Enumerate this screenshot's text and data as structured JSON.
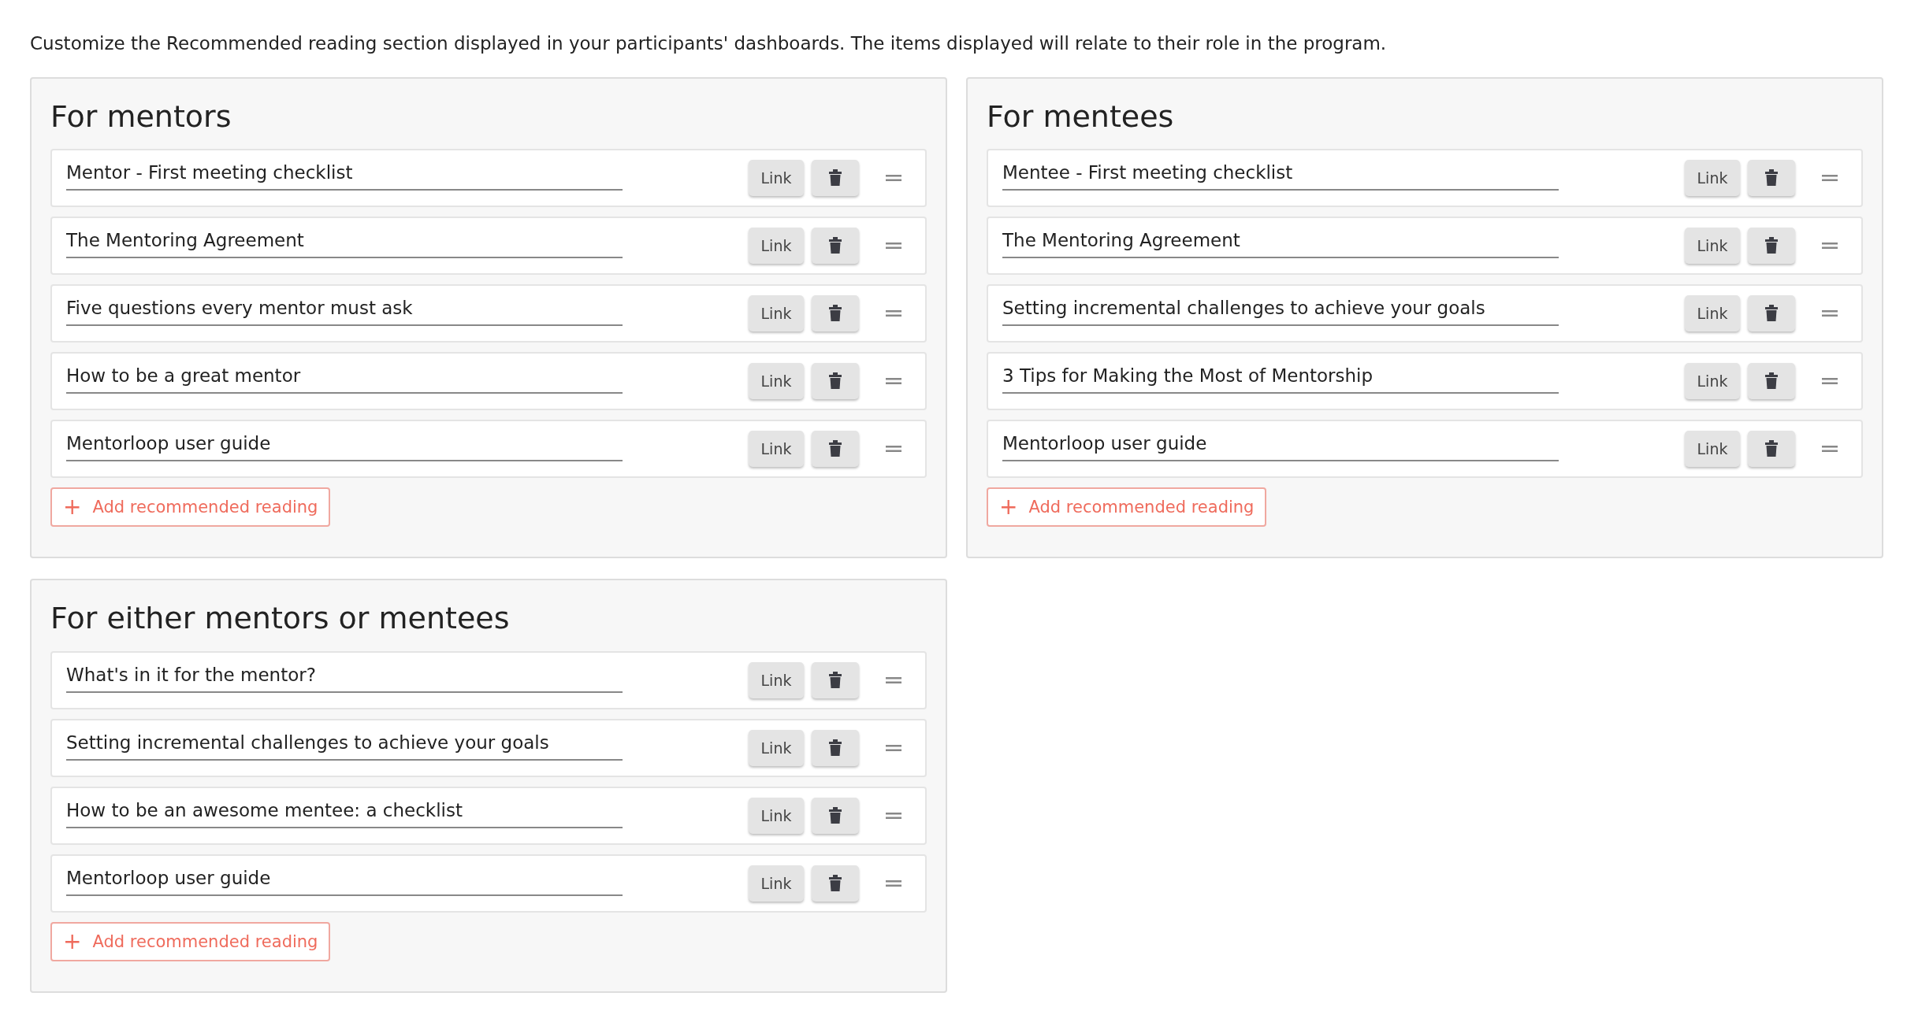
{
  "intro": "Customize the Recommended reading section displayed in your participants' dashboards. The items displayed will relate to their role in the program.",
  "sections": [
    {
      "title": "For mentors",
      "items": [
        {
          "value": "Mentor - First meeting checklist",
          "link": "Link"
        },
        {
          "value": "The Mentoring Agreement",
          "link": "Link"
        },
        {
          "value": "Five questions every mentor must ask",
          "link": "Link"
        },
        {
          "value": "How to be a great mentor",
          "link": "Link"
        },
        {
          "value": "Mentorloop user guide",
          "link": "Link"
        }
      ],
      "add_button": {
        "icon": "+",
        "label": "Add recommended reading"
      }
    },
    {
      "title": "For mentees",
      "items": [
        {
          "value": "Mentee - First meeting checklist",
          "link": "Link"
        },
        {
          "value": "The Mentoring Agreement",
          "link": "Link"
        },
        {
          "value": "Setting incremental challenges to achieve your goals",
          "link": "Link"
        },
        {
          "value": "3 Tips for Making the Most of Mentorship",
          "link": "Link"
        },
        {
          "value": "Mentorloop user guide",
          "link": "Link"
        }
      ],
      "add_button": {
        "icon": "+",
        "label": "Add recommended reading"
      }
    },
    {
      "title": "For either mentors or mentees",
      "items": [
        {
          "value": "What's in it for the mentor?",
          "link": "Link"
        },
        {
          "value": "Setting incremental challenges to achieve your goals",
          "link": "Link"
        },
        {
          "value": "How to be an awesome mentee: a checklist",
          "link": "Link"
        },
        {
          "value": "Mentorloop user guide",
          "link": "Link"
        }
      ],
      "add_button": {
        "icon": "+",
        "label": "Add recommended reading"
      }
    }
  ]
}
